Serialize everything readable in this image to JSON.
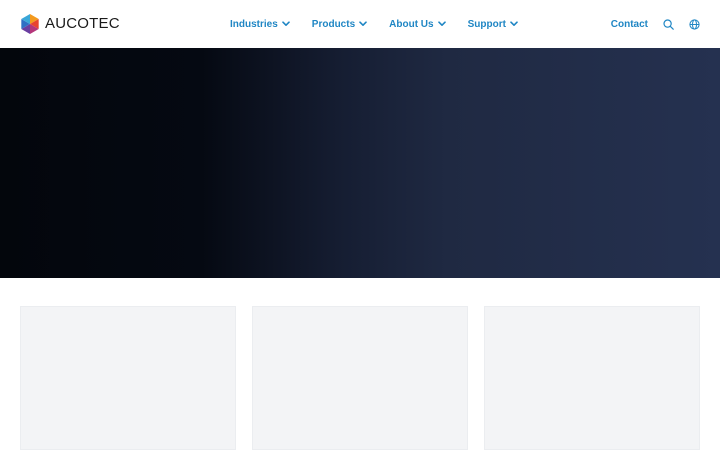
{
  "header": {
    "logo_text": "AUCOTEC",
    "nav": [
      {
        "label": "Industries"
      },
      {
        "label": "Products"
      },
      {
        "label": "About Us"
      },
      {
        "label": "Support"
      }
    ],
    "contact_label": "Contact",
    "icons": [
      "search-icon",
      "globe-icon"
    ]
  },
  "colors": {
    "accent": "#1f86c4",
    "hero_dark": "#03060c",
    "hero_light": "#253150",
    "card_bg": "#f3f4f6"
  }
}
